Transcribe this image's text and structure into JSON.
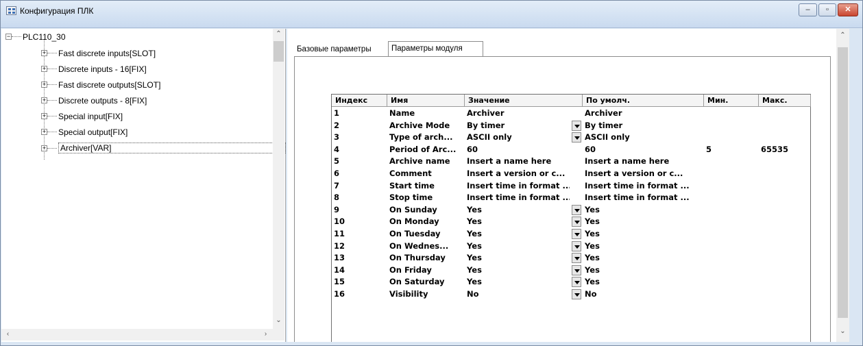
{
  "window": {
    "title": "Конфигурация ПЛК",
    "minimize": "–",
    "maximize": "▫",
    "close": "✕"
  },
  "tree": {
    "root": "PLC110_30",
    "items": [
      {
        "label": "Fast discrete inputs[SLOT]"
      },
      {
        "label": "Discrete inputs - 16[FIX]"
      },
      {
        "label": "Fast discrete outputs[SLOT]"
      },
      {
        "label": "Discrete outputs - 8[FIX]"
      },
      {
        "label": "Special input[FIX]"
      },
      {
        "label": "Special output[FIX]"
      },
      {
        "label": "Archiver[VAR]"
      }
    ]
  },
  "tabs": [
    {
      "label": "Базовые параметры"
    },
    {
      "label": "Параметры модуля"
    }
  ],
  "table": {
    "headers": [
      "Индекс",
      "Имя",
      "Значение",
      "По умолч.",
      "Мин.",
      "Макс."
    ],
    "rows": [
      [
        "1",
        "Name",
        "Archiver",
        "Archiver",
        "",
        ""
      ],
      [
        "2",
        "Archive Mode",
        "By timer",
        "By timer",
        "",
        ""
      ],
      [
        "3",
        "Type of arch...",
        "ASCII only",
        "ASCII only",
        "",
        ""
      ],
      [
        "4",
        "Period of Arc...",
        "60",
        "60",
        "5",
        "65535"
      ],
      [
        "5",
        "Archive name",
        "Insert a name here",
        "Insert a name here",
        "",
        ""
      ],
      [
        "6",
        "Comment",
        "Insert a version or c...",
        "Insert a version or c...",
        "",
        ""
      ],
      [
        "7",
        "Start time",
        "Insert time in format ...",
        "Insert time in format ...",
        "",
        ""
      ],
      [
        "8",
        "Stop time",
        "Insert time in format ...",
        "Insert time in format ...",
        "",
        ""
      ],
      [
        "9",
        "On Sunday",
        "Yes",
        "Yes",
        "",
        ""
      ],
      [
        "10",
        "On Monday",
        "Yes",
        "Yes",
        "",
        ""
      ],
      [
        "11",
        "On Tuesday",
        "Yes",
        "Yes",
        "",
        ""
      ],
      [
        "12",
        "On Wednes...",
        "Yes",
        "Yes",
        "",
        ""
      ],
      [
        "13",
        "On Thursday",
        "Yes",
        "Yes",
        "",
        ""
      ],
      [
        "14",
        "On Friday",
        "Yes",
        "Yes",
        "",
        ""
      ],
      [
        "15",
        "On Saturday",
        "Yes",
        "Yes",
        "",
        ""
      ],
      [
        "16",
        "Visibility",
        "No",
        "No",
        "",
        ""
      ]
    ],
    "dropdown_rows": [
      2,
      3,
      9,
      10,
      11,
      12,
      13,
      14,
      15,
      16
    ]
  }
}
